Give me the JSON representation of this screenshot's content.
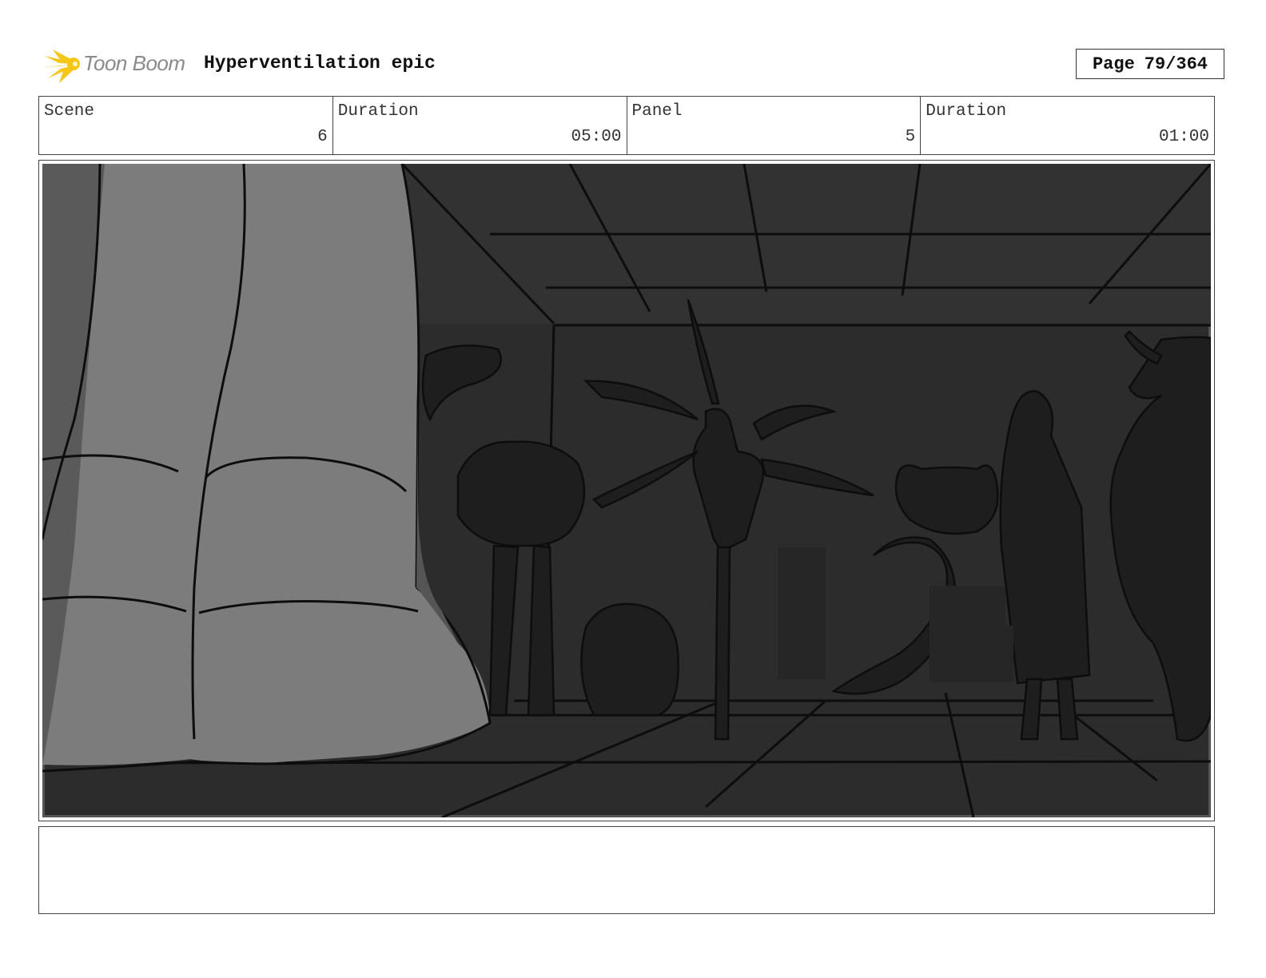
{
  "header": {
    "logo_text": "Toon Boom",
    "project_title": "Hyperventilation epic",
    "page_label": "Page",
    "page_number": "79/364"
  },
  "info": {
    "scene_label": "Scene",
    "scene_value": "6",
    "scene_duration_label": "Duration",
    "scene_duration_value": "05:00",
    "panel_label": "Panel",
    "panel_value": "5",
    "panel_duration_label": "Duration",
    "panel_duration_value": "01:00"
  },
  "notes": {
    "text": ""
  },
  "colors": {
    "logo_yellow": "#f5c518",
    "panel_dark": "#2e2e2e",
    "foot_grey": "#7a7a7a"
  }
}
